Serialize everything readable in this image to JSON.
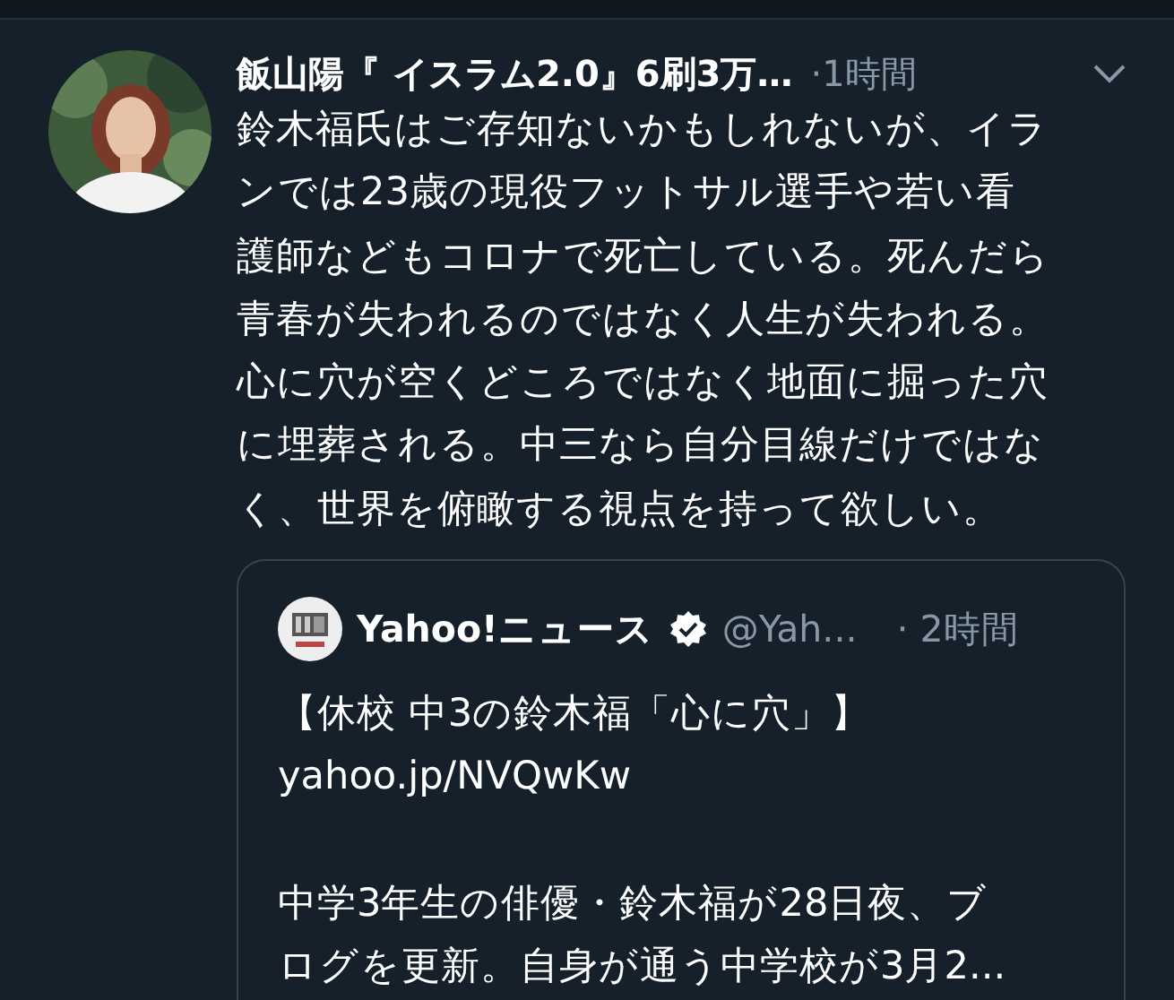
{
  "tweet": {
    "author": "飯山陽『 イスラム2.0』6刷3万…",
    "time": "·1時間",
    "body_lines": [
      "鈴木福氏はご存知ないかもしれないが、イラ",
      "ンでは23歳の現役フットサル選手や若い看",
      "護師などもコロナで死亡している。死んだら",
      "青春が失われるのではなく人生が失われる。",
      "心に穴が空くどころではなく地面に掘った穴",
      "に埋葬される。中三なら自分目線だけではな",
      "く、世界を俯瞰する視点を持って欲しい。"
    ],
    "quote": {
      "author": "Yahoo!ニュース",
      "verified": true,
      "handle": "@Yah...",
      "time": "· 2時間",
      "headline": "【休校 中3の鈴木福「心に穴」】",
      "link": "yahoo.jp/NVQwKw",
      "summary_lines": [
        "中学3年生の俳優・鈴木福が28日夜、ブ",
        "ログを更新。自身が通う中学校が3月2..."
      ]
    }
  }
}
